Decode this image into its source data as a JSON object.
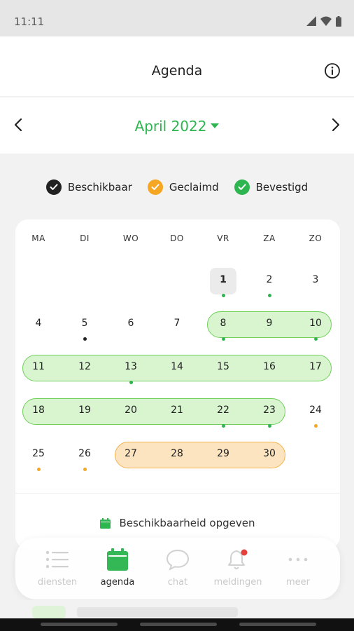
{
  "status_bar": {
    "time": "11:11"
  },
  "header": {
    "title": "Agenda"
  },
  "month_nav": {
    "month": "April 2022"
  },
  "legend": [
    {
      "label": "Beschikbaar",
      "color": "#222222"
    },
    {
      "label": "Geclaimd",
      "color": "#f5a623"
    },
    {
      "label": "Bevestigd",
      "color": "#2db54f"
    }
  ],
  "calendar": {
    "weekdays": [
      "MA",
      "DI",
      "WO",
      "DO",
      "VR",
      "ZA",
      "ZO"
    ],
    "today": 1,
    "weeks": [
      [
        null,
        null,
        null,
        null,
        1,
        2,
        3
      ],
      [
        4,
        5,
        6,
        7,
        8,
        9,
        10
      ],
      [
        11,
        12,
        13,
        14,
        15,
        16,
        17
      ],
      [
        18,
        19,
        20,
        21,
        22,
        23,
        24
      ],
      [
        25,
        26,
        27,
        28,
        29,
        30,
        null
      ]
    ],
    "green_ranges": [
      {
        "week": 1,
        "from": 4,
        "to": 6
      },
      {
        "week": 2,
        "from": 0,
        "to": 6
      },
      {
        "week": 3,
        "from": 0,
        "to": 5
      }
    ],
    "orange_ranges": [
      {
        "week": 4,
        "from": 2,
        "to": 5
      }
    ],
    "markers": [
      {
        "day": 1,
        "color": "green"
      },
      {
        "day": 2,
        "color": "green"
      },
      {
        "day": 5,
        "color": "black"
      },
      {
        "day": 8,
        "color": "green"
      },
      {
        "day": 10,
        "color": "green"
      },
      {
        "day": 13,
        "color": "green"
      },
      {
        "day": 22,
        "color": "green"
      },
      {
        "day": 23,
        "color": "green"
      },
      {
        "day": 24,
        "color": "orange"
      },
      {
        "day": 25,
        "color": "orange"
      },
      {
        "day": 26,
        "color": "orange"
      }
    ],
    "action_label": "Beschikbaarheid opgeven"
  },
  "bottom_nav": {
    "active": "agenda",
    "tabs": [
      {
        "id": "diensten",
        "label": "diensten",
        "icon": "list-icon"
      },
      {
        "id": "agenda",
        "label": "agenda",
        "icon": "calendar-icon"
      },
      {
        "id": "chat",
        "label": "chat",
        "icon": "chat-bubble-icon"
      },
      {
        "id": "meldingen",
        "label": "meldingen",
        "icon": "bell-icon"
      },
      {
        "id": "meer",
        "label": "meer",
        "icon": "more-dots-icon"
      }
    ]
  },
  "colors": {
    "accent_green": "#2db54f",
    "confirmed_fill": "#d8f5cf",
    "claimed_fill": "#fde4c0",
    "claimed_orange": "#f5a623",
    "notification_red": "#e53935"
  }
}
